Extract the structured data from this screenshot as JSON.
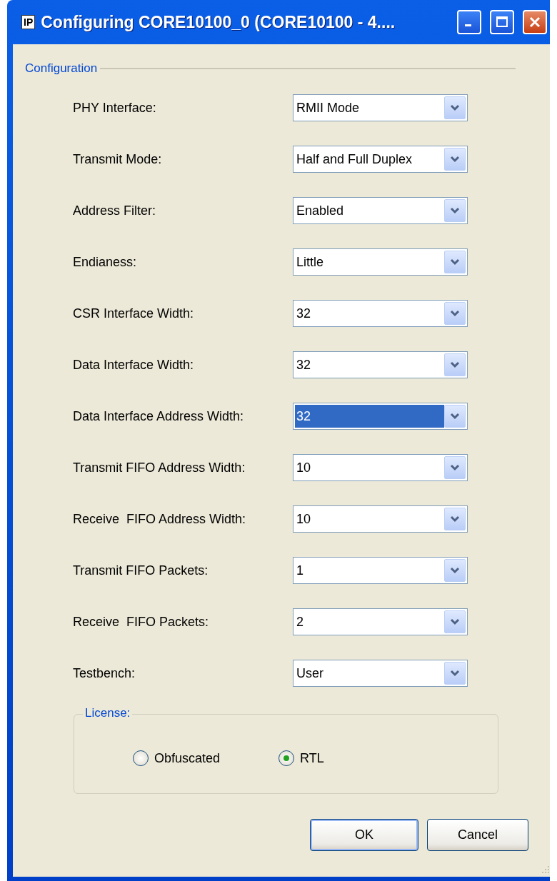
{
  "window": {
    "title": "Configuring CORE10100_0 (CORE10100 - 4....",
    "icon_text": "IP"
  },
  "configuration": {
    "legend": "Configuration",
    "fields": [
      {
        "label": "PHY Interface:",
        "value": "RMII Mode",
        "focused": false
      },
      {
        "label": "Transmit Mode:",
        "value": "Half and Full Duplex",
        "focused": false
      },
      {
        "label": "Address Filter:",
        "value": "Enabled",
        "focused": false
      },
      {
        "label": "Endianess:",
        "value": "Little",
        "focused": false
      },
      {
        "label": "CSR Interface Width:",
        "value": "32",
        "focused": false
      },
      {
        "label": "Data Interface Width:",
        "value": "32",
        "focused": false
      },
      {
        "label": "Data Interface Address Width:",
        "value": "32",
        "focused": true
      },
      {
        "label": "Transmit FIFO Address Width:",
        "value": "10",
        "focused": false
      },
      {
        "label": "Receive  FIFO Address Width:",
        "value": "10",
        "focused": false
      },
      {
        "label": "Transmit FIFO Packets:",
        "value": "1",
        "focused": false
      },
      {
        "label": "Receive  FIFO Packets:",
        "value": "2",
        "focused": false
      },
      {
        "label": "Testbench:",
        "value": "User",
        "focused": false
      }
    ]
  },
  "license": {
    "legend": "License:",
    "options": [
      {
        "label": "Obfuscated",
        "selected": false
      },
      {
        "label": "RTL",
        "selected": true
      }
    ]
  },
  "buttons": [
    {
      "label": "OK",
      "default": true
    },
    {
      "label": "Cancel",
      "default": false
    }
  ]
}
